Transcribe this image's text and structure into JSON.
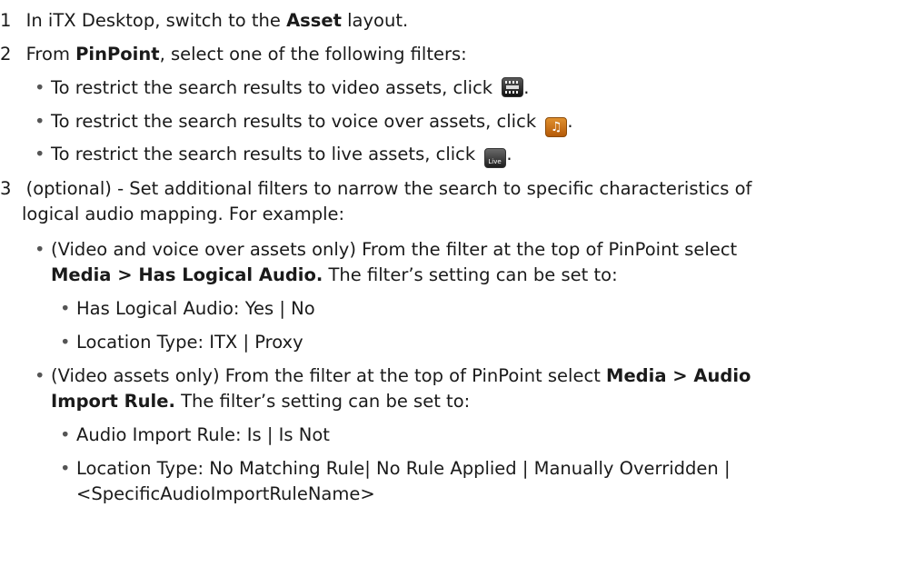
{
  "steps": [
    {
      "n": "1",
      "a": "In iTX Desktop, switch to the ",
      "b": "Asset",
      "c": " layout."
    },
    {
      "n": "2",
      "a": "From ",
      "b": "PinPoint",
      "c": ", select one of the following filters:"
    },
    {
      "n": "3",
      "a": "(optional) - Set additional filters to narrow the search to specific characteristics of",
      "a2": "logical audio mapping. For example:"
    }
  ],
  "step2_bullets": [
    {
      "text": "To restrict the search results to video assets, click ",
      "icon": "video-filter-icon",
      "end": "."
    },
    {
      "text": "To restrict the search results to voice over assets, click ",
      "icon": "voice-over-filter-icon",
      "end": "."
    },
    {
      "text": "To restrict the search results to live assets, click ",
      "icon": "live-filter-icon",
      "icon_text": "Live",
      "end": "."
    }
  ],
  "step3_items": [
    {
      "l1": "(Video and voice over assets only) From the filter at the top of PinPoint select",
      "l2b": "Media > Has Logical Audio.",
      "l2": " The filter’s setting can be set to:",
      "subs": [
        "Has Logical Audio: Yes | No",
        "Location Type: ITX | Proxy"
      ]
    },
    {
      "l1": "(Video assets only) From the filter at the top of PinPoint select ",
      "l1b": "Media > Audio",
      "l2b": "Import Rule.",
      "l2": " The filter’s setting can be set to:",
      "subs": [
        "Audio Import Rule: Is | Is Not",
        "Location Type: No Matching Rule| No Rule Applied | Manually Overridden |",
        "<SpecificAudioImportRuleName>"
      ]
    }
  ]
}
